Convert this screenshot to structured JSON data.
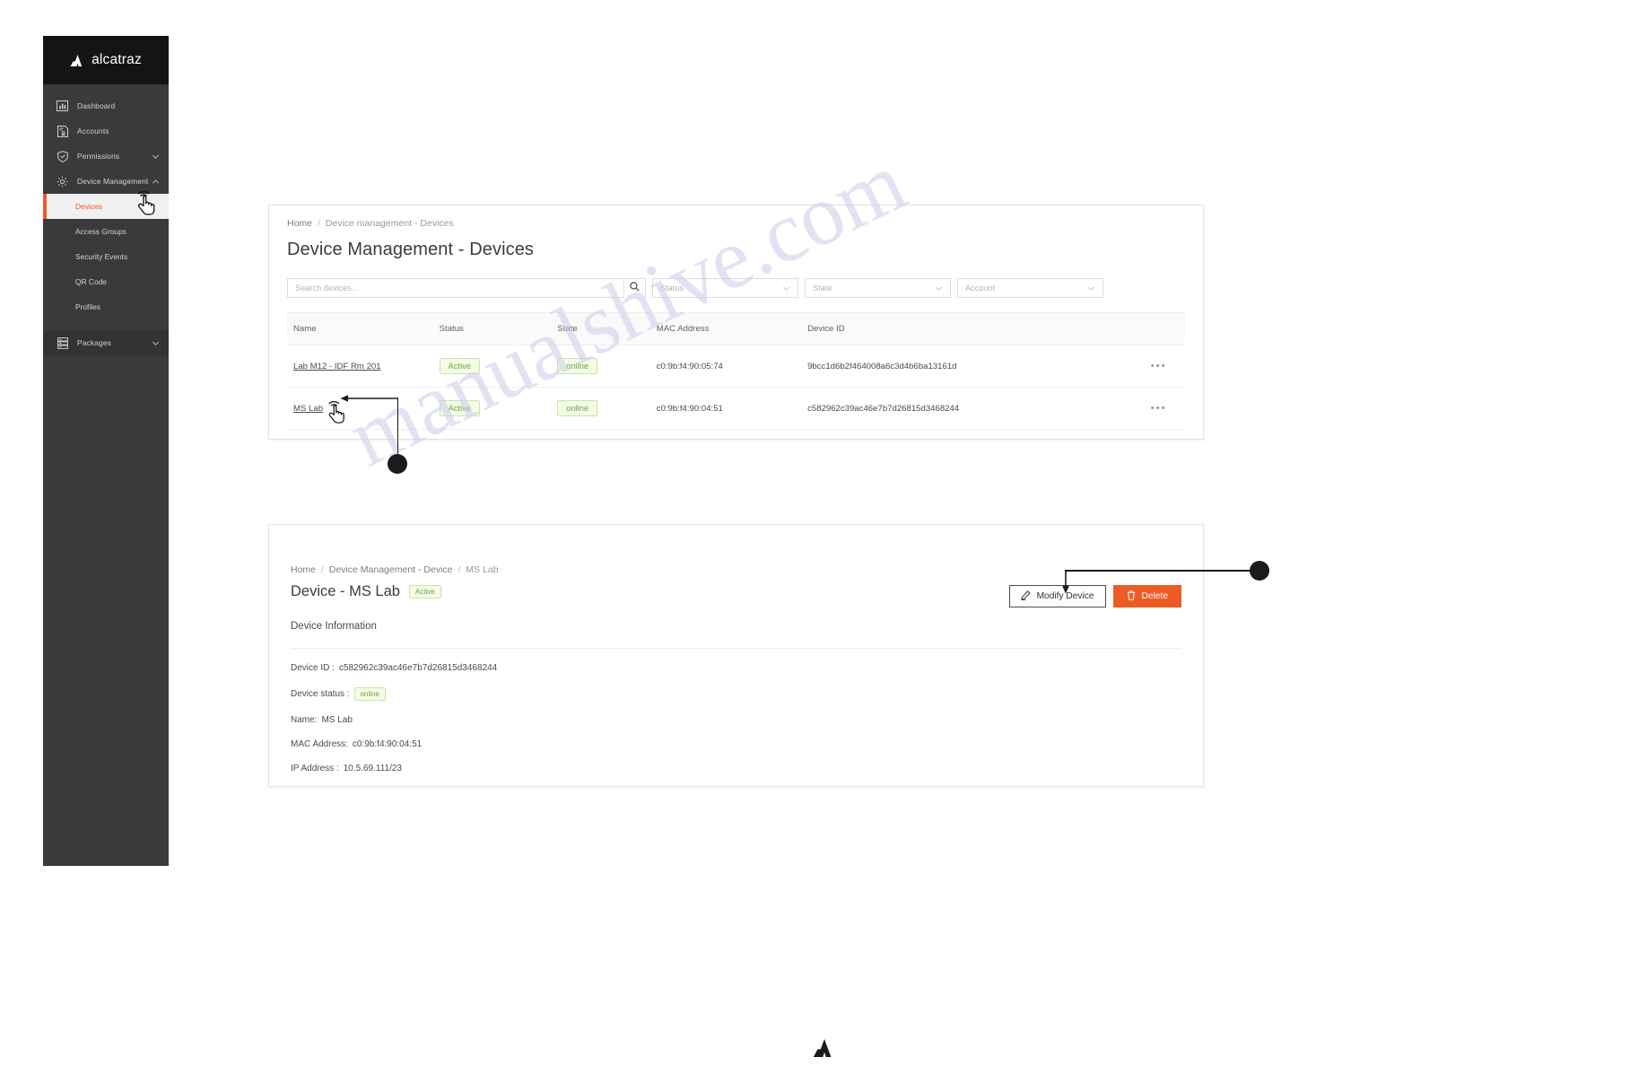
{
  "brand": {
    "name": "alcatraz",
    "logo_icon": "alcatraz-a-mark",
    "accent": "#ef5b25"
  },
  "sidebar": {
    "items": [
      {
        "label": "Dashboard",
        "icon": "bar-chart-icon",
        "chevron": ""
      },
      {
        "label": "Accounts",
        "icon": "account-card-icon",
        "chevron": ""
      },
      {
        "label": "Permissions",
        "icon": "shield-check-icon",
        "chevron": "chevron-down-icon"
      },
      {
        "label": "Device Management",
        "icon": "gear-icon",
        "chevron": "chevron-up-icon"
      }
    ],
    "subitems": [
      {
        "label": "Devices",
        "active": true
      },
      {
        "label": "Access Groups",
        "active": false
      },
      {
        "label": "Security Events",
        "active": false
      },
      {
        "label": "QR Code",
        "active": false
      },
      {
        "label": "Profiles",
        "active": false
      }
    ],
    "packages": {
      "label": "Packages",
      "icon": "server-stack-icon",
      "chevron": "chevron-down-icon"
    }
  },
  "list_view": {
    "breadcrumb": {
      "home": "Home",
      "sep": "/",
      "current": "Device management - Devices"
    },
    "title": "Device Management - Devices",
    "search": {
      "placeholder": "Search devices...",
      "value": "",
      "icon": "search-icon"
    },
    "filters": [
      {
        "label": "Status",
        "icon": "chevron-down-icon"
      },
      {
        "label": "State",
        "icon": "chevron-down-icon"
      },
      {
        "label": "Account",
        "icon": "chevron-down-icon"
      }
    ],
    "columns": [
      "Name",
      "Status",
      "State",
      "MAC Address",
      "Device ID",
      ""
    ],
    "rows": [
      {
        "name": "Lab M12 - IDF Rm 201",
        "status": "Active",
        "state": "online",
        "mac": "c0:9b:f4:90:05:74",
        "device_id": "9bcc1d6b2f464008a6c3d4b6ba13161d",
        "more": "•••"
      },
      {
        "name": "MS Lab",
        "status": "Active",
        "state": "online",
        "mac": "c0:9b:f4:90:04:51",
        "device_id": "c582962c39ac46e7b7d26815d3468244",
        "more": "•••"
      }
    ]
  },
  "detail_view": {
    "breadcrumb": {
      "home": "Home",
      "sep": "/",
      "mid": "Device Management - Device",
      "current": "MS Lab"
    },
    "title": "Device - MS Lab",
    "status_badge": "Active",
    "section_label": "Device Information",
    "fields": [
      {
        "label": "Device ID :",
        "value": "c582962c39ac46e7b7d26815d3468244",
        "badge": false
      },
      {
        "label": "Device status :",
        "value": "online",
        "badge": true
      },
      {
        "label": "Name:",
        "value": "MS Lab",
        "badge": false
      },
      {
        "label": "MAC Address:",
        "value": "c0:9b:f4:90:04:51",
        "badge": false
      },
      {
        "label": "IP Address :",
        "value": "10.5.69.111/23",
        "badge": false
      }
    ],
    "buttons": [
      {
        "label": "Modify Device",
        "icon": "pencil-icon",
        "style": "outline"
      },
      {
        "label": "Delete",
        "icon": "trash-icon",
        "style": "danger"
      }
    ]
  },
  "annotations": {
    "callout_row": {
      "target": "MS Lab",
      "marker": "step-dot"
    },
    "callout_buttons": {
      "target": "Modify Device",
      "marker": "step-dot"
    }
  },
  "watermark": {
    "text": "manualshive.com"
  },
  "footer": {
    "logo_icon": "alcatraz-a-mark"
  }
}
